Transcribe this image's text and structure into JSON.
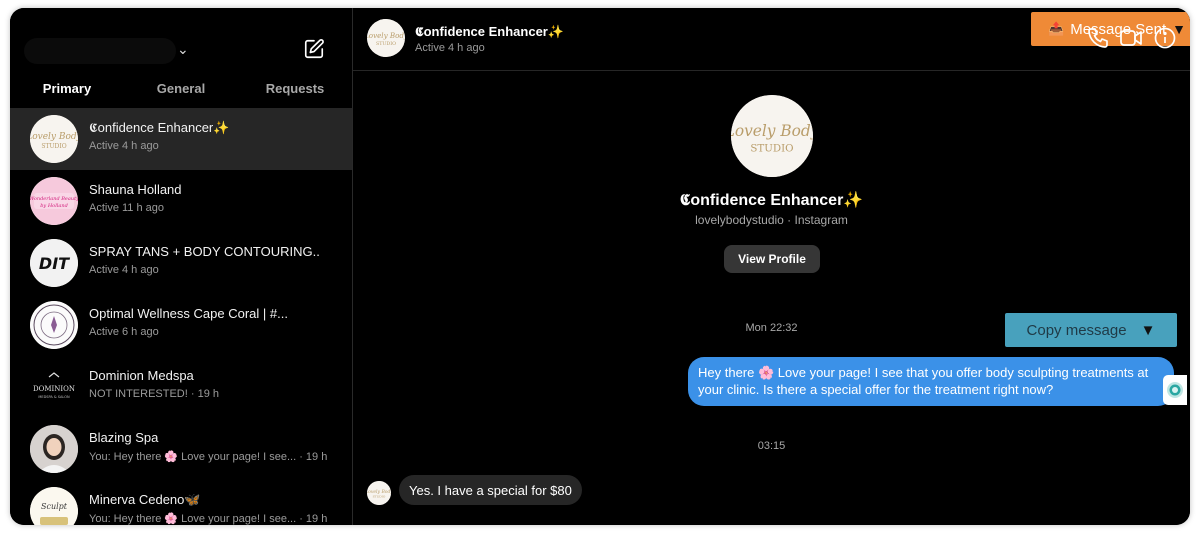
{
  "sidebar": {
    "tabs": [
      {
        "label": "Primary",
        "active": true
      },
      {
        "label": "General",
        "active": false
      },
      {
        "label": "Requests",
        "active": false
      }
    ],
    "conversations": [
      {
        "name": "𝕮onfidence Enhancer✨",
        "subtitle": "Active 4 h ago",
        "selected": true,
        "avatar": "lovely-body-studio-logo"
      },
      {
        "name": "Shauna Holland",
        "subtitle": "Active 11 h ago",
        "avatar": "pink-logo"
      },
      {
        "name": "SPRAY TANS + BODY CONTOURING...",
        "subtitle": "Active 4 h ago",
        "avatar": "dit-logo"
      },
      {
        "name": "Optimal Wellness Cape Coral | #...",
        "subtitle": "Active 6 h ago",
        "avatar": "seal-logo"
      },
      {
        "name": "Dominion Medspa",
        "subtitle": "NOT INTERESTED! · 19 h",
        "avatar": "dominion-logo"
      },
      {
        "name": "Blazing Spa",
        "subtitle": "You: Hey there 🌸 Love your page! I see... · 19 h",
        "avatar": "person-photo"
      },
      {
        "name": "Minerva Cedeno🦋",
        "subtitle": "You: Hey there 🌸 Love your page! I see... · 19 h",
        "avatar": "gold-logo"
      }
    ]
  },
  "header": {
    "name": "𝕮onfidence Enhancer✨",
    "status": "Active 4 h ago",
    "icons": [
      "phone-icon",
      "video-icon",
      "info-icon"
    ]
  },
  "extension": {
    "message_sent_label": "Message Sent",
    "message_sent_icon": "📤",
    "copy_label": "Copy message",
    "arrow": "▼"
  },
  "profile": {
    "name": "𝕮onfidence Enhancer✨",
    "subtitle": "lovelybodystudio · Instagram",
    "view_button": "View Profile"
  },
  "thread": {
    "timestamp1": "Mon 22:32",
    "outgoing_message": "Hey there 🌸 Love your page! I see that you offer body sculpting treatments at your clinic. Is there a special offer for the treatment right now?",
    "timestamp2": "03:15",
    "incoming_message": "Yes. I have a special for $80"
  },
  "colors": {
    "outgoing_bubble": "#3b91e8",
    "incoming_bubble": "#262626",
    "orange_button": "#ef8a37",
    "teal_button": "#48a1bd"
  }
}
